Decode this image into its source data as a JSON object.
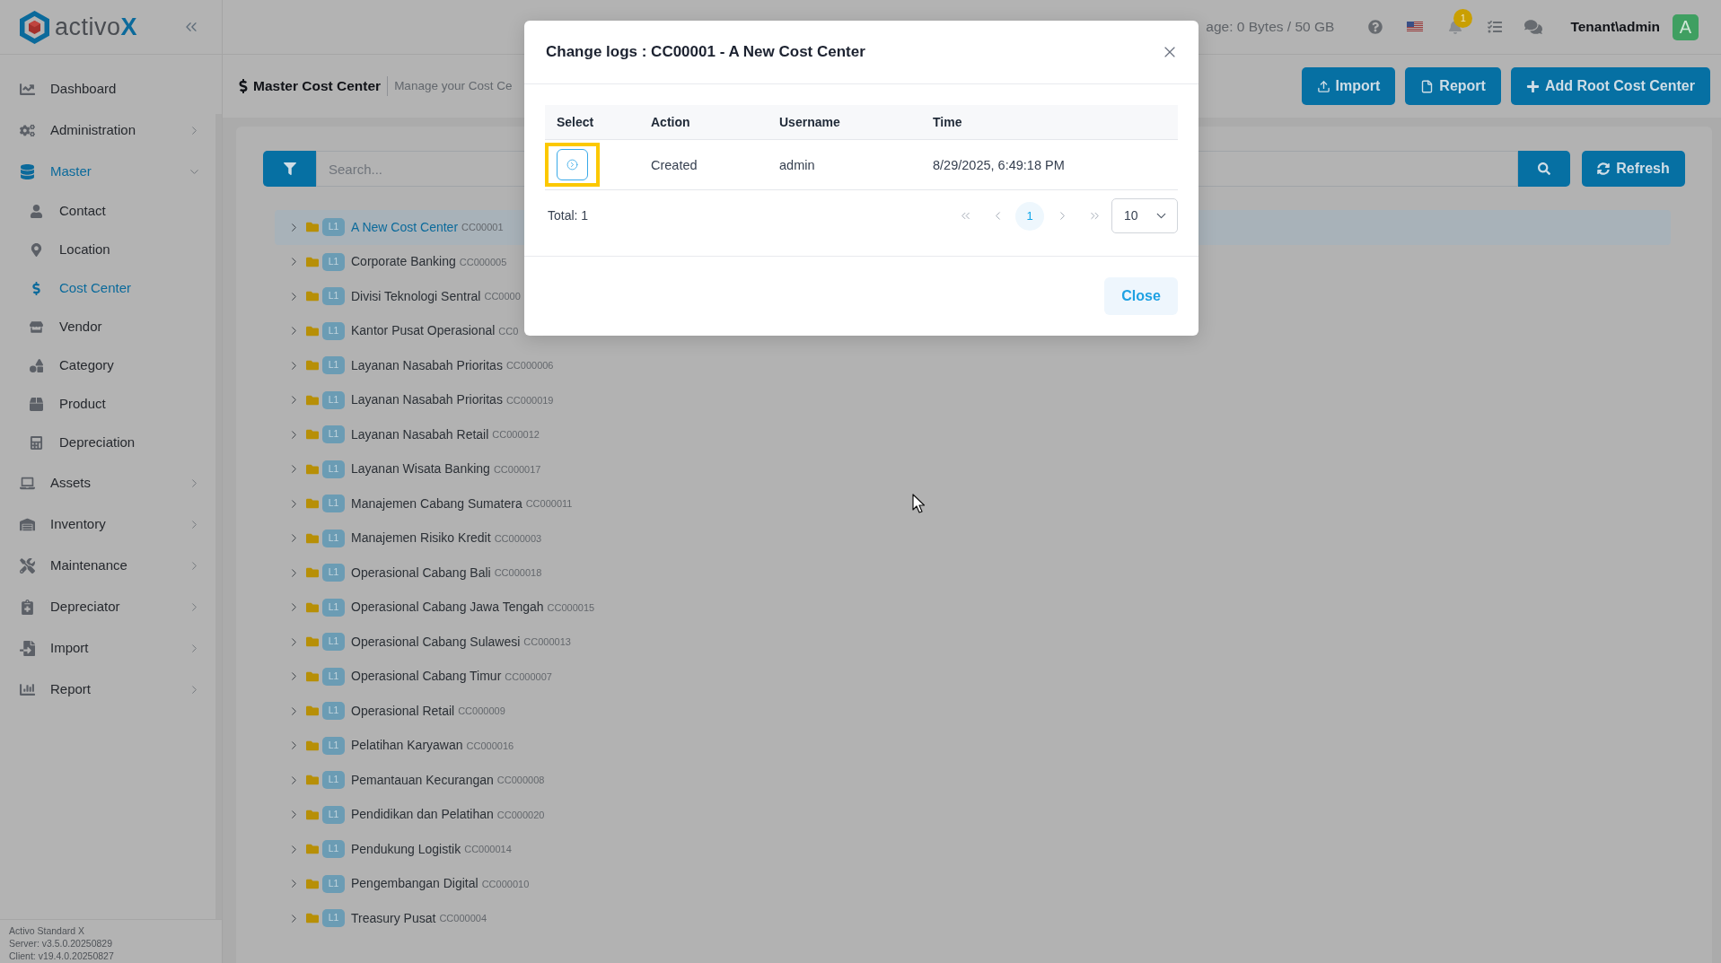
{
  "sidebar": {
    "logo": "activo**X**",
    "items": [
      {
        "label": "Dashboard",
        "selected": false
      },
      {
        "label": "Administration",
        "selected": false,
        "expanded": false
      },
      {
        "label": "Master",
        "selected": true,
        "expanded": true,
        "children": [
          {
            "label": "Contact",
            "selected": false
          },
          {
            "label": "Location",
            "selected": false
          },
          {
            "label": "Cost Center",
            "selected": true
          },
          {
            "label": "Vendor",
            "selected": false
          },
          {
            "label": "Category",
            "selected": false
          },
          {
            "label": "Product",
            "selected": false
          },
          {
            "label": "Depreciation",
            "selected": false
          }
        ]
      },
      {
        "label": "Assets",
        "selected": false,
        "expanded": false
      },
      {
        "label": "Inventory",
        "selected": false,
        "expanded": false
      },
      {
        "label": "Maintenance",
        "selected": false,
        "expanded": false
      },
      {
        "label": "Depreciator",
        "selected": false,
        "expanded": false
      },
      {
        "label": "Import",
        "selected": false,
        "expanded": false
      },
      {
        "label": "Report",
        "selected": false,
        "expanded": false
      }
    ],
    "footer": [
      "Activo Standard X",
      "Server: v3.5.0.20250829",
      "Client: v19.4.0.20250827"
    ]
  },
  "topbar": {
    "storage": "age: 0 Bytes / 50 GB",
    "notification_count": "1",
    "user": "Tenant\\admin",
    "avatar": "A"
  },
  "page_header": {
    "title": "Master Cost Center",
    "subtitle": "Manage your Cost Ce",
    "buttons": [
      {
        "label": "Import"
      },
      {
        "label": "Report"
      },
      {
        "label": "Add Root Cost Center"
      }
    ]
  },
  "search": {
    "placeholder": "Search...",
    "refresh_label": "Refresh"
  },
  "tree": [
    {
      "name": "A New Cost Center",
      "code": "CC00001",
      "badge": "L1",
      "selected": true,
      "expanded": false
    },
    {
      "name": "Corporate Banking",
      "code": "CC000005",
      "badge": "L1",
      "selected": false,
      "expanded": false
    },
    {
      "name": "Divisi Teknologi Sentral",
      "code": "CC0000",
      "badge": "L1",
      "selected": false,
      "expanded": false
    },
    {
      "name": "Kantor Pusat Operasional",
      "code": "CC0",
      "badge": "L1",
      "selected": false,
      "expanded": false
    },
    {
      "name": "Layanan Nasabah Prioritas",
      "code": "CC000006",
      "badge": "L1",
      "selected": false,
      "expanded": false
    },
    {
      "name": "Layanan Nasabah Prioritas",
      "code": "CC000019",
      "badge": "L1",
      "selected": false,
      "expanded": false
    },
    {
      "name": "Layanan Nasabah Retail",
      "code": "CC000012",
      "badge": "L1",
      "selected": false,
      "expanded": false
    },
    {
      "name": "Layanan Wisata Banking",
      "code": "CC000017",
      "badge": "L1",
      "selected": false,
      "expanded": false
    },
    {
      "name": "Manajemen Cabang Sumatera",
      "code": "CC000011",
      "badge": "L1",
      "selected": false,
      "expanded": false
    },
    {
      "name": "Manajemen Risiko Kredit",
      "code": "CC000003",
      "badge": "L1",
      "selected": false,
      "expanded": false
    },
    {
      "name": "Operasional Cabang Bali",
      "code": "CC000018",
      "badge": "L1",
      "selected": false,
      "expanded": false
    },
    {
      "name": "Operasional Cabang Jawa Tengah",
      "code": "CC000015",
      "badge": "L1",
      "selected": false,
      "expanded": false
    },
    {
      "name": "Operasional Cabang Sulawesi",
      "code": "CC000013",
      "badge": "L1",
      "selected": false,
      "expanded": false
    },
    {
      "name": "Operasional Cabang Timur",
      "code": "CC000007",
      "badge": "L1",
      "selected": false,
      "expanded": false
    },
    {
      "name": "Operasional Retail",
      "code": "CC000009",
      "badge": "L1",
      "selected": false,
      "expanded": false
    },
    {
      "name": "Pelatihan Karyawan",
      "code": "CC000016",
      "badge": "L1",
      "selected": false,
      "expanded": false
    },
    {
      "name": "Pemantauan Kecurangan",
      "code": "CC000008",
      "badge": "L1",
      "selected": false,
      "expanded": false
    },
    {
      "name": "Pendidikan dan Pelatihan",
      "code": "CC000020",
      "badge": "L1",
      "selected": false,
      "expanded": false
    },
    {
      "name": "Pendukung Logistik",
      "code": "CC000014",
      "badge": "L1",
      "selected": false,
      "expanded": false
    },
    {
      "name": "Pengembangan Digital",
      "code": "CC000010",
      "badge": "L1",
      "selected": false,
      "expanded": false
    },
    {
      "name": "Treasury Pusat",
      "code": "CC000004",
      "badge": "L1",
      "selected": false,
      "expanded": false
    }
  ],
  "modal": {
    "title": "Change logs : CC00001 - A New Cost Center",
    "columns": [
      "Select",
      "Action",
      "Username",
      "Time"
    ],
    "rows": [
      {
        "action": "Created",
        "username": "admin",
        "time": "8/29/2025, 6:49:18 PM",
        "highlighted": true
      }
    ],
    "total": "Total: 1",
    "pages": [
      {
        "label": "1",
        "selected": true
      }
    ],
    "page_size": "10",
    "close_label": "Close"
  }
}
